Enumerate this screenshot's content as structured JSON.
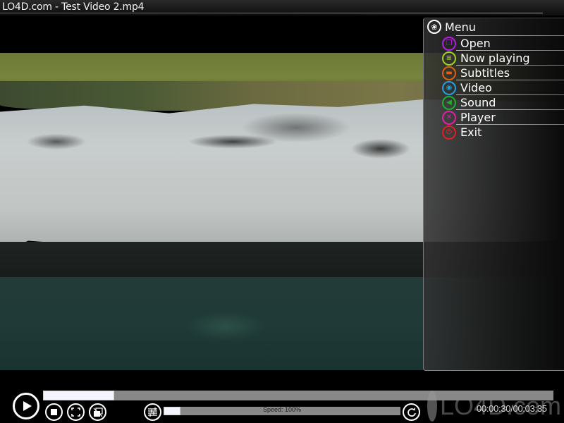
{
  "window": {
    "title": "LO4D.com - Test Video 2.mp4"
  },
  "menu": {
    "header_label": "Menu",
    "header_icon": "menu-flower-icon",
    "items": [
      {
        "label": "Open",
        "icon": "open-icon",
        "color": "#b020e0",
        "glyph": "❐"
      },
      {
        "label": "Now playing",
        "icon": "playlist-icon",
        "color": "#a0d020",
        "glyph": "≡"
      },
      {
        "label": "Subtitles",
        "icon": "subtitles-icon",
        "color": "#e06010",
        "glyph": "▬"
      },
      {
        "label": "Video",
        "icon": "camera-icon",
        "color": "#20a0e0",
        "glyph": "◉"
      },
      {
        "label": "Sound",
        "icon": "speaker-icon",
        "color": "#20b030",
        "glyph": "◀"
      },
      {
        "label": "Player",
        "icon": "tools-icon",
        "color": "#e020a0",
        "glyph": "✕"
      },
      {
        "label": "Exit",
        "icon": "power-icon",
        "color": "#e02020",
        "glyph": "⏻"
      }
    ]
  },
  "controls": {
    "play_icon": "play-icon",
    "stop_icon": "stop-icon",
    "fullscreen_icon": "fullscreen-icon",
    "window_mode_icon": "window-mode-icon",
    "equalizer_icon": "equalizer-icon",
    "repeat_icon": "repeat-icon",
    "progress_fraction": 0.14,
    "speed_fraction": 0.07,
    "speed_label": "Speed: 100%",
    "time_elapsed": "00:00:30",
    "time_total": "00:03:35",
    "time_display": "00:00:30/00:03:35"
  },
  "watermark": {
    "text": "LO4D.com"
  }
}
